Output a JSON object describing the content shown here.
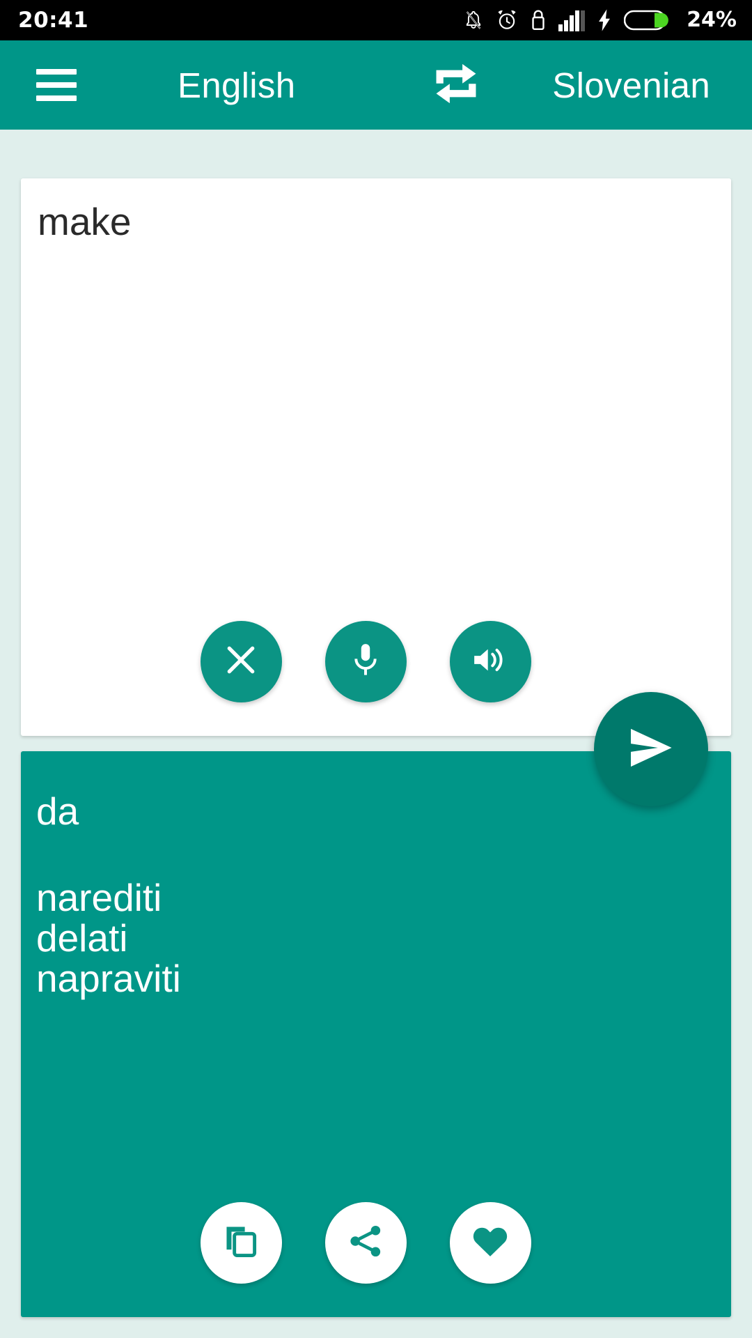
{
  "statusbar": {
    "time": "20:41",
    "battery_percent": "24%",
    "icons": [
      "notifications-off-icon",
      "alarm-icon",
      "usb-lock-icon",
      "signal-icon",
      "charging-bolt-icon",
      "battery-icon"
    ]
  },
  "appbar": {
    "menu_icon": "hamburger-menu-icon",
    "source_language": "English",
    "swap_icon": "swap-languages-icon",
    "target_language": "Slovenian"
  },
  "source": {
    "text": "make",
    "placeholder": "",
    "actions": [
      {
        "name": "clear-button",
        "icon": "close-icon"
      },
      {
        "name": "voice-input-button",
        "icon": "microphone-icon"
      },
      {
        "name": "speak-source-button",
        "icon": "speaker-icon"
      }
    ]
  },
  "send": {
    "name": "translate-send-button",
    "icon": "send-icon"
  },
  "target": {
    "primary": "da",
    "alternatives": [
      "narediti",
      "delati",
      "napraviti"
    ],
    "actions": [
      {
        "name": "copy-button",
        "icon": "copy-icon"
      },
      {
        "name": "share-button",
        "icon": "share-icon"
      },
      {
        "name": "favorite-button",
        "icon": "heart-icon"
      }
    ]
  },
  "colors": {
    "primary": "#009688",
    "primary_dark": "#00796b",
    "button_teal": "#0b9484",
    "background": "#e0efec",
    "card": "#ffffff",
    "status_bar": "#000000",
    "battery_green": "#4cd522"
  }
}
